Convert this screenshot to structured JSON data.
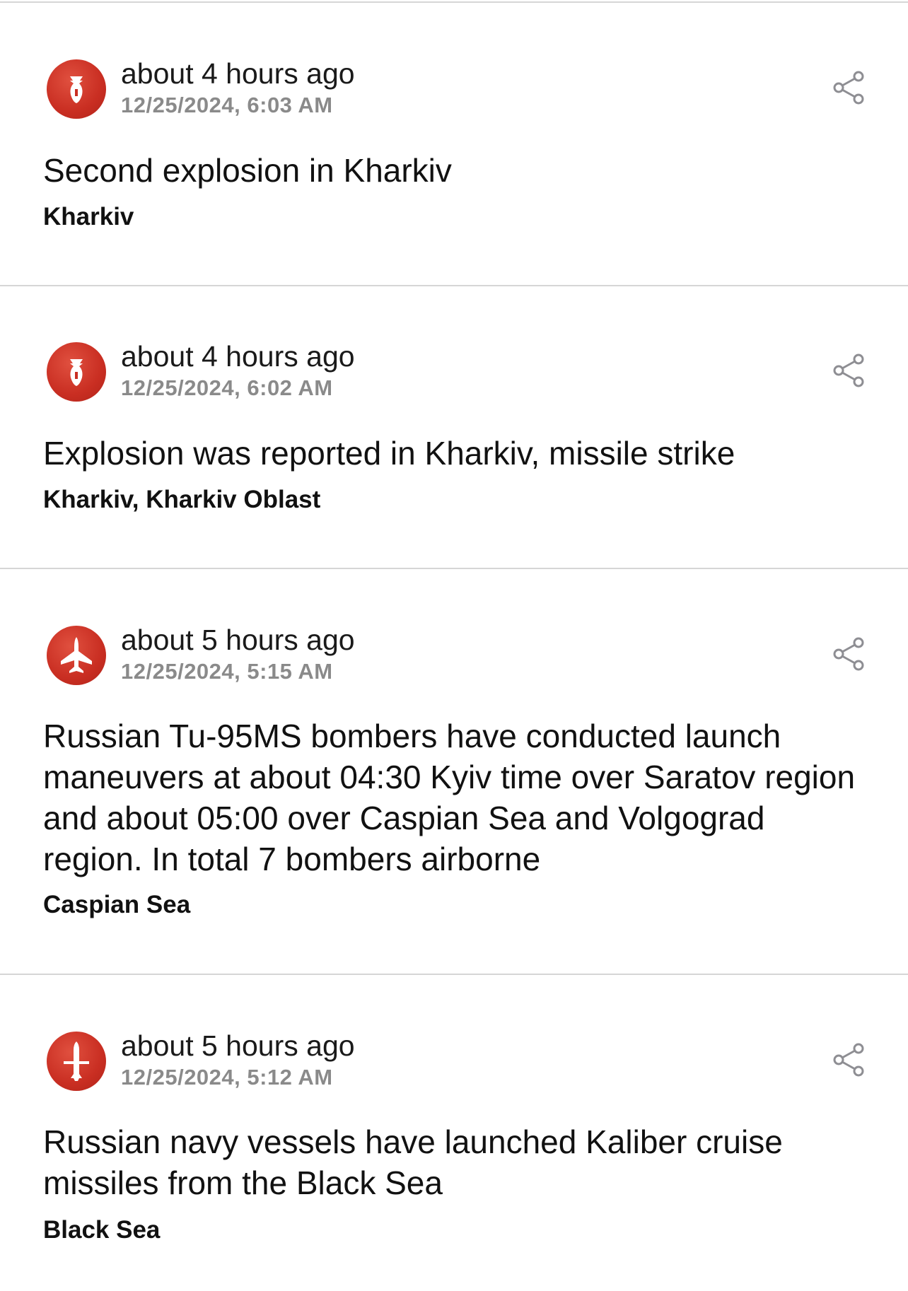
{
  "feed": {
    "items": [
      {
        "icon": "bomb-icon",
        "relative_time": "about 4 hours ago",
        "timestamp": "12/25/2024, 6:03 AM",
        "title": "Second explosion in Kharkiv",
        "location": "Kharkiv"
      },
      {
        "icon": "bomb-icon",
        "relative_time": "about 4 hours ago",
        "timestamp": "12/25/2024, 6:02 AM",
        "title": "Explosion was reported in Kharkiv, missile strike",
        "location": "Kharkiv, Kharkiv Oblast"
      },
      {
        "icon": "bomber-plane-icon",
        "relative_time": "about 5 hours ago",
        "timestamp": "12/25/2024, 5:15 AM",
        "title": "Russian Tu-95MS bombers have conducted launch maneuvers at about 04:30 Kyiv time over Saratov region and about 05:00 over Caspian Sea and Volgograd region. In total 7 bombers airborne",
        "location": "Caspian Sea"
      },
      {
        "icon": "cruise-missile-icon",
        "relative_time": "about 5 hours ago",
        "timestamp": "12/25/2024, 5:12 AM",
        "title": "Russian navy vessels have launched Kaliber cruise missiles from the Black Sea",
        "location": "Black Sea"
      }
    ]
  },
  "colors": {
    "icon_red": "#c92e22",
    "divider": "#d6d6d6",
    "timestamp_gray": "#8a8a8a",
    "share_icon_gray": "#8e8e93"
  }
}
